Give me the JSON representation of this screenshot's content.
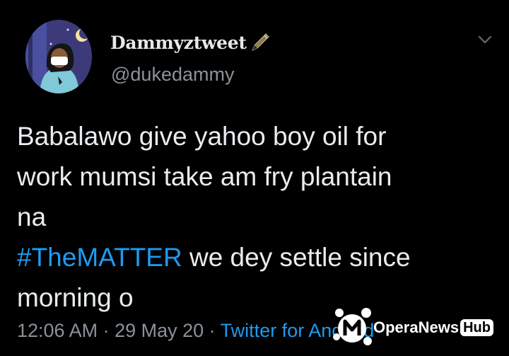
{
  "author": {
    "display_name": "Dammyztweet",
    "handle": "@dukedammy",
    "avatar_icon": "avatar-illustration"
  },
  "tweet": {
    "lines": [
      "Babalawo give yahoo boy oil for",
      "work mumsi take am fry plantain",
      "na"
    ],
    "hashtag": "#TheMATTER",
    "hashtag_rest": " we dey settle since",
    "last_line": "morning o"
  },
  "meta": {
    "time": "12:06 AM",
    "separator1": " · ",
    "date": "29 May 20",
    "separator2": " · ",
    "source": "Twitter for Android"
  },
  "watermark": {
    "brand": "OperaNews",
    "badge": "Hub"
  },
  "colors": {
    "background": "#000000",
    "link": "#1d9bf0",
    "secondary_text": "#8a9299"
  },
  "icons": {
    "menu": "chevron-down-icon",
    "emoji": "pen-icon"
  }
}
